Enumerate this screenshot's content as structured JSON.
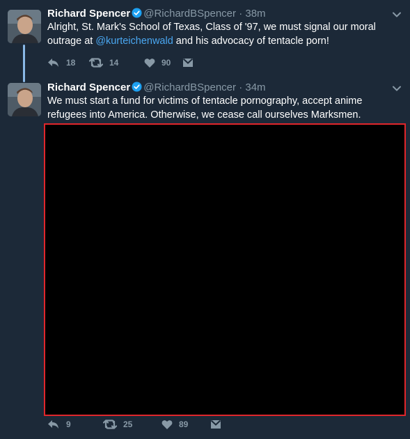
{
  "tweets": [
    {
      "author": {
        "name": "Richard Spencer",
        "handle": "@RichardBSpencer",
        "verified": true
      },
      "separator": "·",
      "time": "38m",
      "text": {
        "before": "Alright, St. Mark's School of Texas, Class of '97, we must signal our moral outrage at ",
        "mention": "@kurteichenwald",
        "after": " and his advocacy of tentacle porn!"
      },
      "actions": {
        "replies": "18",
        "retweets": "14",
        "likes": "90"
      }
    },
    {
      "author": {
        "name": "Richard Spencer",
        "handle": "@RichardBSpencer",
        "verified": true
      },
      "separator": "·",
      "time": "34m",
      "text": {
        "before": "We must start a fund for victims of tentacle pornography, accept anime refugees into America. Otherwise, we cease call ourselves Marksmen."
      },
      "media": {
        "color": "#000000",
        "border_color": "#e0262b"
      },
      "actions": {
        "replies": "9",
        "retweets": "25",
        "likes": "89"
      }
    }
  ],
  "icons": [
    "avatar",
    "verified-icon",
    "chevron-down-icon",
    "reply-icon",
    "retweet-icon",
    "heart-icon",
    "message-icon"
  ],
  "colors": {
    "background": "#1c2938",
    "secondary_text": "#8899a6",
    "link": "#4aa7f1",
    "thread_line": "#8ab8e6",
    "verified": "#1da1f2"
  }
}
